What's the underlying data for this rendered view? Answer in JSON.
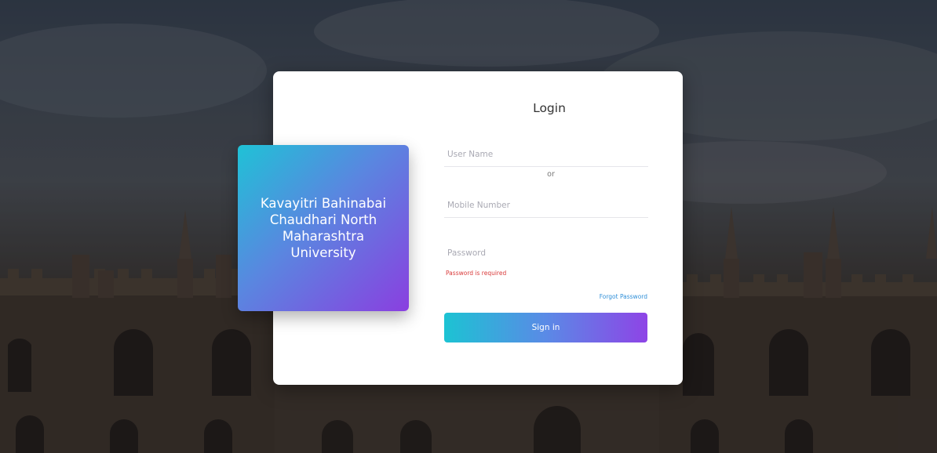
{
  "brand": {
    "name": "Kavayitri Bahinabai\nChaudhari North\nMaharashtra\nUniversity"
  },
  "login": {
    "title": "Login",
    "username_placeholder": "User Name",
    "or_label": "or",
    "mobile_placeholder": "Mobile Number",
    "password_placeholder": "Password",
    "password_error": "Password is required",
    "forgot_password_label": "Forgot Password",
    "sign_in_label": "Sign in"
  },
  "colors": {
    "gradient_start": "#1fc2d6",
    "gradient_end": "#8a3fe0",
    "error": "#d93a3a",
    "link": "#2f8fd8"
  }
}
